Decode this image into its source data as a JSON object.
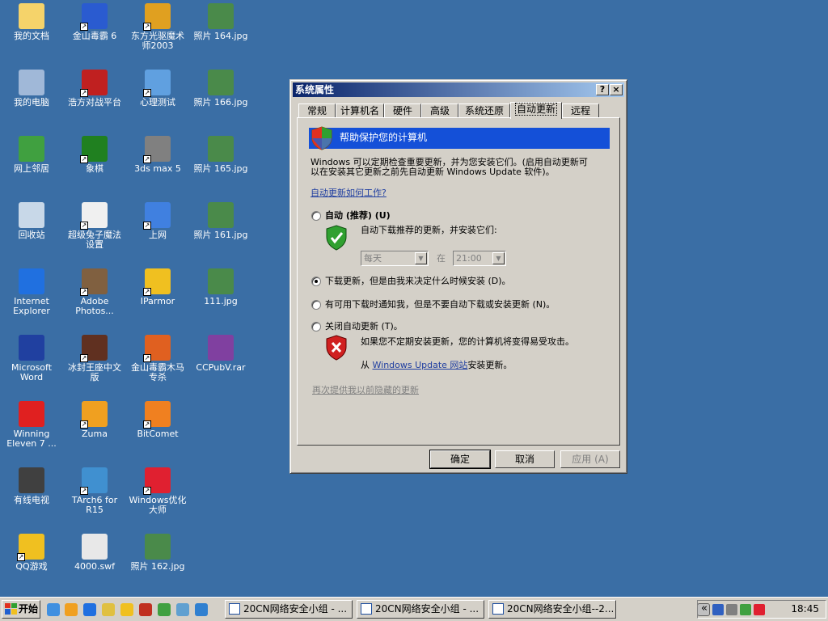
{
  "desktop": {
    "icons": [
      {
        "label": "我的文档",
        "color": "#f5d36a"
      },
      {
        "label": "金山毒霸 6",
        "color": "#2a5bd0"
      },
      {
        "label": "东方光驱魔术师2003",
        "color": "#e0a020"
      },
      {
        "label": "照片 164.jpg",
        "color": "#4a8a4a"
      },
      {
        "label": "我的电脑",
        "color": "#a0b8d8"
      },
      {
        "label": "浩方对战平台",
        "color": "#c02020"
      },
      {
        "label": "心理测试",
        "color": "#60a0e0"
      },
      {
        "label": "照片 166.jpg",
        "color": "#4a8a4a"
      },
      {
        "label": "网上邻居",
        "color": "#40a040"
      },
      {
        "label": "象棋",
        "color": "#208020"
      },
      {
        "label": "3ds max 5",
        "color": "#808080"
      },
      {
        "label": "照片 165.jpg",
        "color": "#4a8a4a"
      },
      {
        "label": "回收站",
        "color": "#c8d8e8"
      },
      {
        "label": "超级兔子魔法设置",
        "color": "#f0f0f0"
      },
      {
        "label": "上网",
        "color": "#4080e0"
      },
      {
        "label": "照片 161.jpg",
        "color": "#4a8a4a"
      },
      {
        "label": "Internet Explorer",
        "color": "#2070e0"
      },
      {
        "label": "Adobe Photos...",
        "color": "#806040"
      },
      {
        "label": "IParmor",
        "color": "#f0c020"
      },
      {
        "label": "111.jpg",
        "color": "#4a8a4a"
      },
      {
        "label": "Microsoft Word",
        "color": "#2040a0"
      },
      {
        "label": "冰封王座中文版",
        "color": "#603020"
      },
      {
        "label": "金山毒霸木马专杀",
        "color": "#e06020"
      },
      {
        "label": "CCPubV.rar",
        "color": "#8040a0"
      },
      {
        "label": "Winning Eleven 7 ...",
        "color": "#e02020"
      },
      {
        "label": "Zuma",
        "color": "#f0a020"
      },
      {
        "label": "BitComet",
        "color": "#f08020"
      },
      {
        "label": "有线电视",
        "color": "#404040"
      },
      {
        "label": "TArch6 for R15",
        "color": "#4090d0"
      },
      {
        "label": "Windows优化大师",
        "color": "#e02030"
      },
      {
        "label": "QQ游戏",
        "color": "#f0c020"
      },
      {
        "label": "4000.swf",
        "color": "#e8e8e8"
      },
      {
        "label": "照片 162.jpg",
        "color": "#4a8a4a"
      }
    ]
  },
  "dialog": {
    "title": "系统属性",
    "help_btn": "?",
    "close_btn": "×",
    "tabs": [
      "常规",
      "计算机名",
      "硬件",
      "高级",
      "系统还原",
      "自动更新",
      "远程"
    ],
    "banner": "帮助保护您的计算机",
    "intro_line1": "Windows 可以定期检查重要更新，并为您安装它们。(启用自动更新可",
    "intro_line2": "以在安装其它更新之前先自动更新 Windows Update 软件)。",
    "how_link": "自动更新如何工作?",
    "opt_auto": "自动 (推荐) (U)",
    "opt_auto_desc": "自动下载推荐的更新，并安装它们:",
    "day_value": "每天",
    "at_label": "在",
    "time_value": "21:00",
    "opt_download": "下载更新，但是由我来决定什么时候安装 (D)。",
    "opt_notify": "有可用下载时通知我，但是不要自动下载或安装更新 (N)。",
    "opt_off": "关闭自动更新 (T)。",
    "off_warning": "如果您不定期安装更新，您的计算机将变得易受攻击。",
    "from_prefix": "从",
    "wu_link": "Windows Update 网站",
    "from_suffix": "安装更新。",
    "hidden_link": "再次提供我以前隐藏的更新",
    "ok": "确定",
    "cancel": "取消",
    "apply": "应用 (A)"
  },
  "taskbar": {
    "start": "开始",
    "tasks": [
      "20CN网络安全小组 - ...",
      "20CN网络安全小组 - ...",
      "20CN网络安全小组--2..."
    ],
    "tray_arrow": "«",
    "clock": "18:45"
  }
}
